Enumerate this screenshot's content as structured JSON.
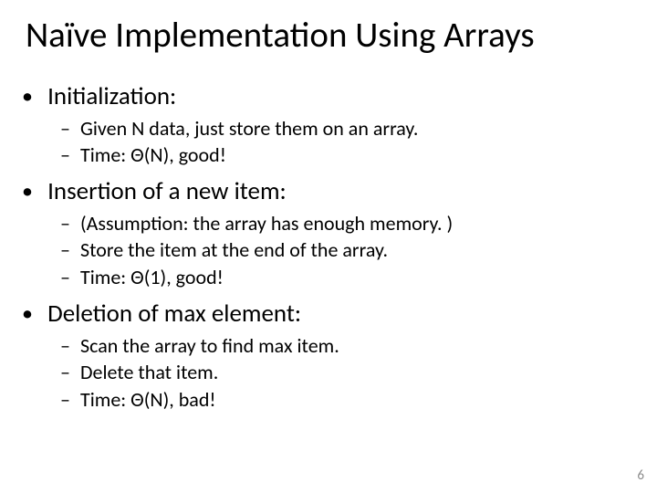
{
  "title": "Naïve Implementation Using Arrays",
  "sections": [
    {
      "heading": "Initialization:",
      "items": [
        "Given N data, just store them on an array.",
        "Time: Θ(N), good!"
      ]
    },
    {
      "heading": "Insertion of a new item:",
      "items": [
        "(Assumption: the array has enough memory. )",
        "Store the item at the end of the array.",
        "Time: Θ(1), good!"
      ]
    },
    {
      "heading": "Deletion of max element:",
      "items": [
        "Scan the array to find max item.",
        "Delete that item.",
        "Time: Θ(N), bad!"
      ]
    }
  ],
  "page_number": "6"
}
